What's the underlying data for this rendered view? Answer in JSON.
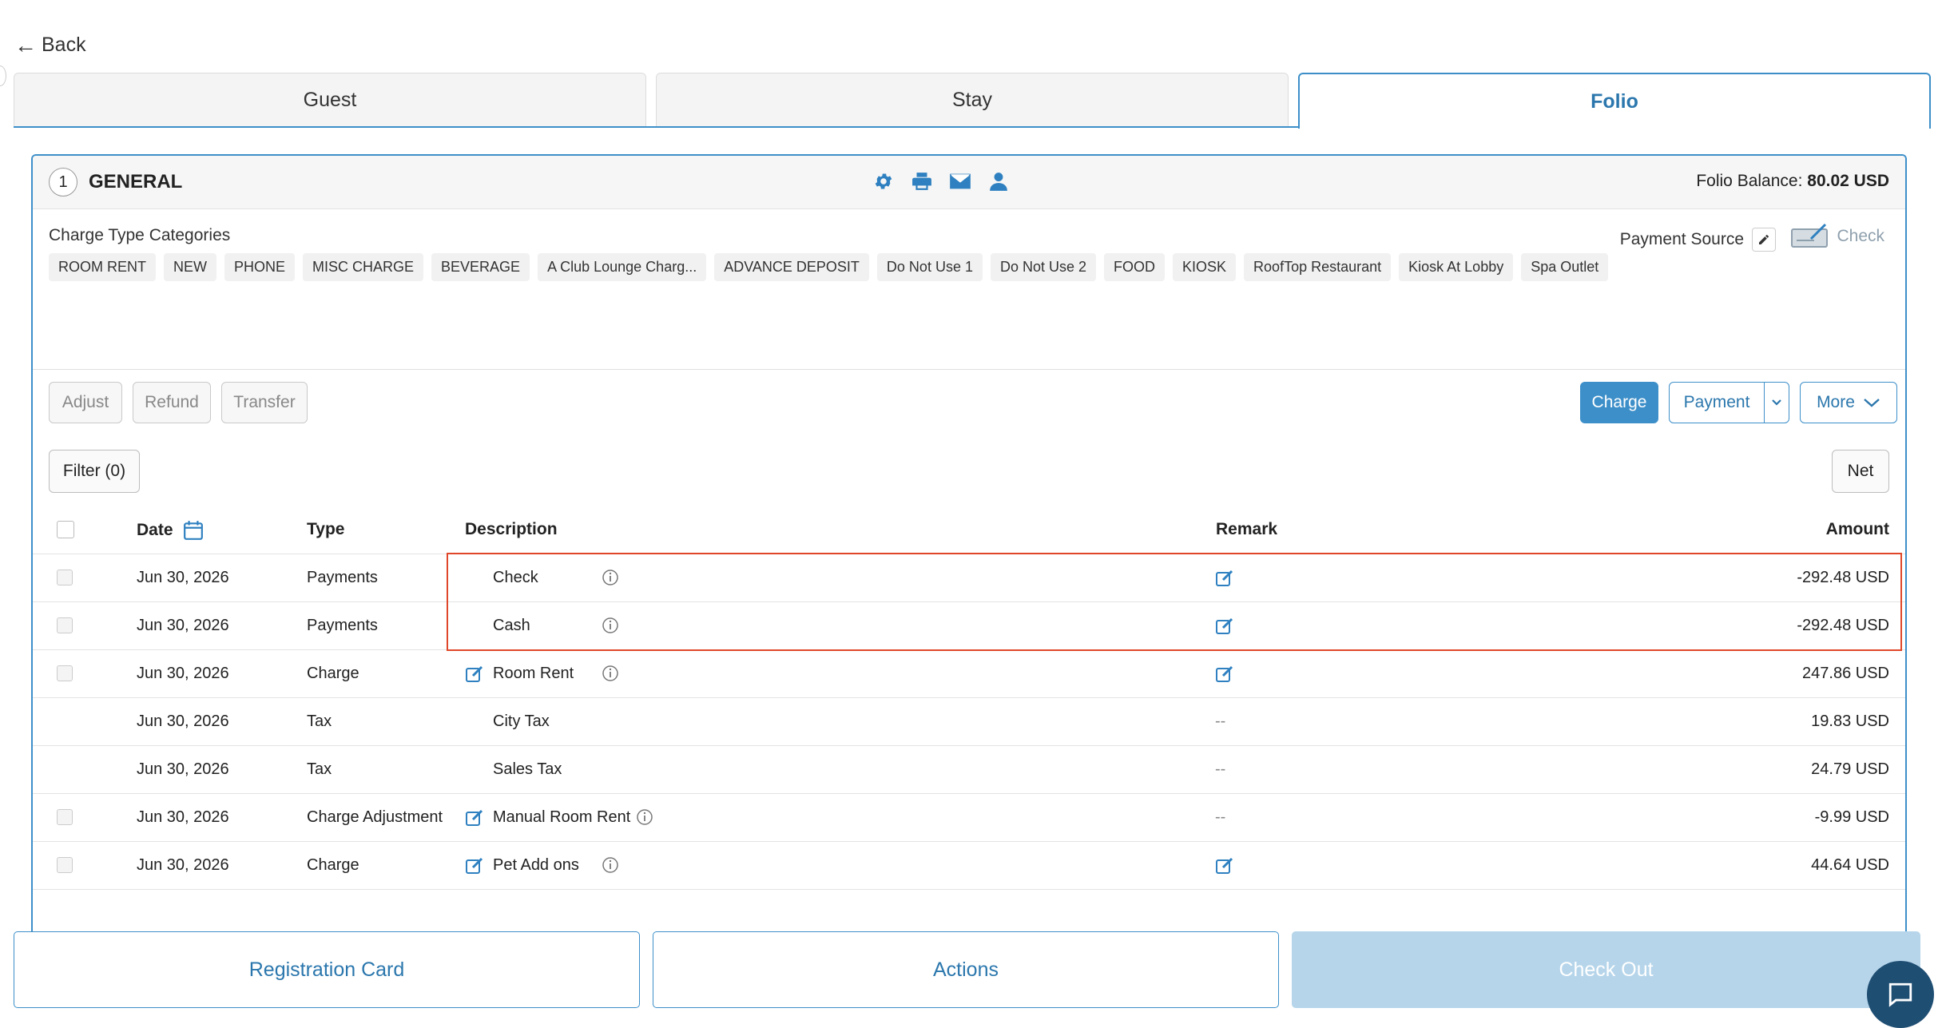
{
  "nav": {
    "back_label": "Back"
  },
  "tabs": [
    {
      "label": "Guest"
    },
    {
      "label": "Stay"
    },
    {
      "label": "Folio"
    }
  ],
  "folio": {
    "number": "1",
    "name": "GENERAL",
    "balance_label": "Folio Balance:",
    "balance_value": "80.02 USD",
    "icons": [
      "gear-icon",
      "printer-icon",
      "envelope-icon",
      "user-icon"
    ]
  },
  "categories": {
    "title": "Charge Type Categories",
    "items": [
      "ROOM RENT",
      "NEW",
      "PHONE",
      "MISC CHARGE",
      "BEVERAGE",
      "A Club Lounge Charg...",
      "ADVANCE DEPOSIT",
      "Do Not Use 1",
      "Do Not Use 2",
      "FOOD",
      "KIOSK",
      "RoofTop Restaurant",
      "Kiosk At Lobby",
      "Spa Outlet"
    ]
  },
  "payment_source": {
    "label": "Payment Source",
    "value": "Check"
  },
  "actions": {
    "adjust": "Adjust",
    "refund": "Refund",
    "transfer": "Transfer",
    "charge": "Charge",
    "payment": "Payment",
    "more": "More",
    "filter": "Filter (0)",
    "net": "Net"
  },
  "table": {
    "headers": {
      "date": "Date",
      "type": "Type",
      "description": "Description",
      "remark": "Remark",
      "amount": "Amount"
    },
    "rows": [
      {
        "date": "Jun 30, 2026",
        "type": "Payments",
        "description": "Check",
        "remark": "edit",
        "amount": "-292.48 USD"
      },
      {
        "date": "Jun 30, 2026",
        "type": "Payments",
        "description": "Cash",
        "remark": "edit",
        "amount": "-292.48 USD"
      },
      {
        "date": "Jun 30, 2026",
        "type": "Charge",
        "description": "Room Rent",
        "remark": "edit",
        "amount": "247.86 USD"
      },
      {
        "date": "Jun 30, 2026",
        "type": "Tax",
        "description": "City Tax",
        "remark": "--",
        "amount": "19.83 USD"
      },
      {
        "date": "Jun 30, 2026",
        "type": "Tax",
        "description": "Sales Tax",
        "remark": "--",
        "amount": "24.79 USD"
      },
      {
        "date": "Jun 30, 2026",
        "type": "Charge Adjustment",
        "description": "Manual Room Rent",
        "remark": "--",
        "amount": "-9.99 USD"
      },
      {
        "date": "Jun 30, 2026",
        "type": "Charge",
        "description": "Pet Add ons",
        "remark": "edit",
        "amount": "44.64 USD"
      }
    ]
  },
  "footer": {
    "registration_card": "Registration Card",
    "actions": "Actions",
    "check_out": "Check Out"
  },
  "colors": {
    "accent": "#3d8fc9",
    "highlight": "#e0472a",
    "chat": "#1f4e73"
  }
}
